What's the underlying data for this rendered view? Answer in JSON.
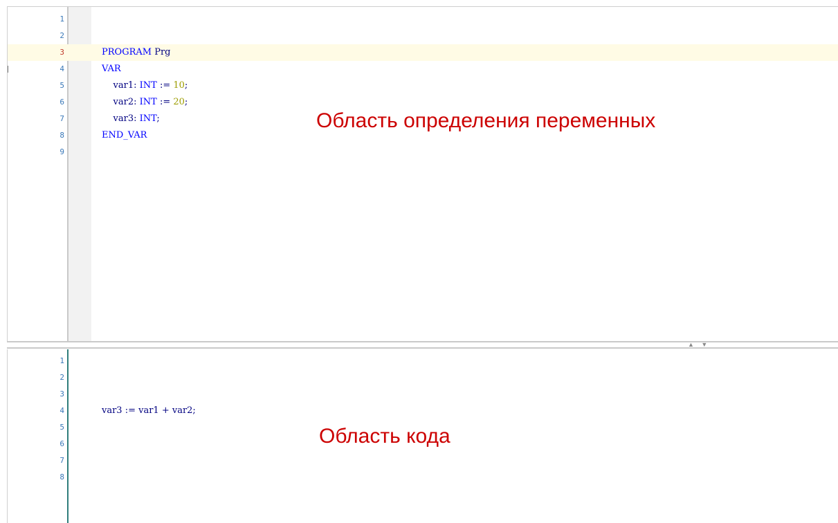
{
  "declaration_pane": {
    "lines": [
      {
        "number": "1",
        "text": ""
      },
      {
        "number": "2",
        "text": ""
      },
      {
        "number": "3",
        "text": "PROGRAM Prg"
      },
      {
        "number": "4",
        "text": "VAR"
      },
      {
        "number": "5",
        "text": "    var1: INT := 10;"
      },
      {
        "number": "6",
        "text": "    var2: INT := 20;"
      },
      {
        "number": "7",
        "text": "    var3: INT;"
      },
      {
        "number": "8",
        "text": "END_VAR"
      },
      {
        "number": "9",
        "text": ""
      }
    ],
    "tokens": {
      "line3": {
        "kw": "PROGRAM",
        "id": " Prg"
      },
      "line4": {
        "kw": "VAR"
      },
      "line5": {
        "id": "    var1: ",
        "kw": "INT",
        "op": " := ",
        "num": "10",
        "end": ";"
      },
      "line6": {
        "id": "    var2: ",
        "kw": "INT",
        "op": " := ",
        "num": "20",
        "end": ";"
      },
      "line7": {
        "id": "    var3: ",
        "kw": "INT",
        "end": ";"
      },
      "line8": {
        "kw": "END_VAR"
      }
    },
    "fold_symbol": "−",
    "annotation": "Область определения переменных"
  },
  "code_pane": {
    "line_numbers": [
      "1",
      "2",
      "3",
      "4",
      "5",
      "6",
      "7",
      "8"
    ],
    "code_line": "var3 := var1 + var2;",
    "annotation": "Область кода"
  },
  "splitter": {
    "arrows": "▲ ▼"
  },
  "colors": {
    "keyword": "#0000ff",
    "identifier": "#000080",
    "number": "#9c9c00",
    "line_number": "#3a78b8",
    "current_line_number": "#c0392b",
    "annotation": "#cc0000",
    "current_line_bg": "#fffbe5"
  }
}
